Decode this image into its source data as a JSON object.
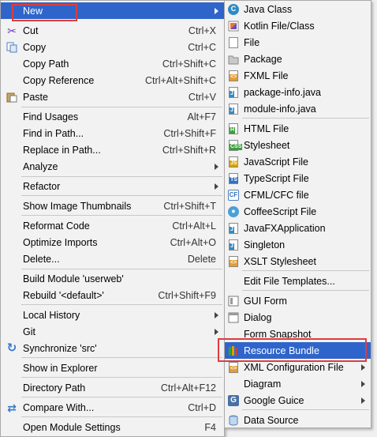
{
  "left_menu": {
    "items": [
      {
        "label": "New",
        "shortcut": "",
        "submenu": true,
        "icon": "new-icon",
        "highlighted": true
      },
      {
        "label": "Cut",
        "shortcut": "Ctrl+X",
        "submenu": false,
        "icon": "scissors-icon"
      },
      {
        "label": "Copy",
        "shortcut": "Ctrl+C",
        "submenu": false,
        "icon": "copy-icon"
      },
      {
        "label": "Copy Path",
        "shortcut": "Ctrl+Shift+C",
        "submenu": false,
        "icon": ""
      },
      {
        "label": "Copy Reference",
        "shortcut": "Ctrl+Alt+Shift+C",
        "submenu": false,
        "icon": ""
      },
      {
        "label": "Paste",
        "shortcut": "Ctrl+V",
        "submenu": false,
        "icon": "paste-icon"
      },
      {
        "label": "Find Usages",
        "shortcut": "Alt+F7",
        "submenu": false,
        "icon": ""
      },
      {
        "label": "Find in Path...",
        "shortcut": "Ctrl+Shift+F",
        "submenu": false,
        "icon": ""
      },
      {
        "label": "Replace in Path...",
        "shortcut": "Ctrl+Shift+R",
        "submenu": false,
        "icon": ""
      },
      {
        "label": "Analyze",
        "shortcut": "",
        "submenu": true,
        "icon": ""
      },
      {
        "label": "Refactor",
        "shortcut": "",
        "submenu": true,
        "icon": ""
      },
      {
        "label": "Show Image Thumbnails",
        "shortcut": "Ctrl+Shift+T",
        "submenu": false,
        "icon": ""
      },
      {
        "label": "Reformat Code",
        "shortcut": "Ctrl+Alt+L",
        "submenu": false,
        "icon": ""
      },
      {
        "label": "Optimize Imports",
        "shortcut": "Ctrl+Alt+O",
        "submenu": false,
        "icon": ""
      },
      {
        "label": "Delete...",
        "shortcut": "Delete",
        "submenu": false,
        "icon": ""
      },
      {
        "label": "Build Module 'userweb'",
        "shortcut": "",
        "submenu": false,
        "icon": ""
      },
      {
        "label": "Rebuild '<default>'",
        "shortcut": "Ctrl+Shift+F9",
        "submenu": false,
        "icon": ""
      },
      {
        "label": "Local History",
        "shortcut": "",
        "submenu": true,
        "icon": ""
      },
      {
        "label": "Git",
        "shortcut": "",
        "submenu": true,
        "icon": ""
      },
      {
        "label": "Synchronize 'src'",
        "shortcut": "",
        "submenu": false,
        "icon": "sync-icon"
      },
      {
        "label": "Show in Explorer",
        "shortcut": "",
        "submenu": false,
        "icon": ""
      },
      {
        "label": "Directory Path",
        "shortcut": "Ctrl+Alt+F12",
        "submenu": false,
        "icon": ""
      },
      {
        "label": "Compare With...",
        "shortcut": "Ctrl+D",
        "submenu": false,
        "icon": "compare-icon"
      },
      {
        "label": "Open Module Settings",
        "shortcut": "F4",
        "submenu": false,
        "icon": ""
      }
    ]
  },
  "right_menu": {
    "items": [
      {
        "label": "Java Class",
        "submenu": false,
        "icon": "java-class-icon"
      },
      {
        "label": "Kotlin File/Class",
        "submenu": false,
        "icon": "kotlin-icon"
      },
      {
        "label": "File",
        "submenu": false,
        "icon": "file-icon"
      },
      {
        "label": "Package",
        "submenu": false,
        "icon": "package-icon"
      },
      {
        "label": "FXML File",
        "submenu": false,
        "icon": "fxml-icon"
      },
      {
        "label": "package-info.java",
        "submenu": false,
        "icon": "java-file-icon"
      },
      {
        "label": "module-info.java",
        "submenu": false,
        "icon": "java-file-icon"
      },
      {
        "label": "HTML File",
        "submenu": false,
        "icon": "html-icon"
      },
      {
        "label": "Stylesheet",
        "submenu": false,
        "icon": "css-icon"
      },
      {
        "label": "JavaScript File",
        "submenu": false,
        "icon": "js-icon"
      },
      {
        "label": "TypeScript File",
        "submenu": false,
        "icon": "ts-icon"
      },
      {
        "label": "CFML/CFC file",
        "submenu": false,
        "icon": "cfml-icon"
      },
      {
        "label": "CoffeeScript File",
        "submenu": false,
        "icon": "coffee-icon"
      },
      {
        "label": "JavaFXApplication",
        "submenu": false,
        "icon": "javafx-icon"
      },
      {
        "label": "Singleton",
        "submenu": false,
        "icon": "singleton-icon"
      },
      {
        "label": "XSLT Stylesheet",
        "submenu": false,
        "icon": "xslt-icon"
      },
      {
        "label": "Edit File Templates...",
        "submenu": false,
        "icon": ""
      },
      {
        "label": "GUI Form",
        "submenu": false,
        "icon": "gui-form-icon"
      },
      {
        "label": "Dialog",
        "submenu": false,
        "icon": "dialog-icon"
      },
      {
        "label": "Form Snapshot",
        "submenu": false,
        "icon": ""
      },
      {
        "label": "Resource Bundle",
        "submenu": false,
        "icon": "resource-bundle-icon",
        "active": true
      },
      {
        "label": "XML Configuration File",
        "submenu": true,
        "icon": "xml-icon"
      },
      {
        "label": "Diagram",
        "submenu": true,
        "icon": ""
      },
      {
        "label": "Google Guice",
        "submenu": true,
        "icon": "guice-icon"
      },
      {
        "label": "Data Source",
        "submenu": false,
        "icon": "database-icon"
      }
    ]
  },
  "colors": {
    "highlight_box": "#e03c3c",
    "active_row": "#2f65ca"
  }
}
